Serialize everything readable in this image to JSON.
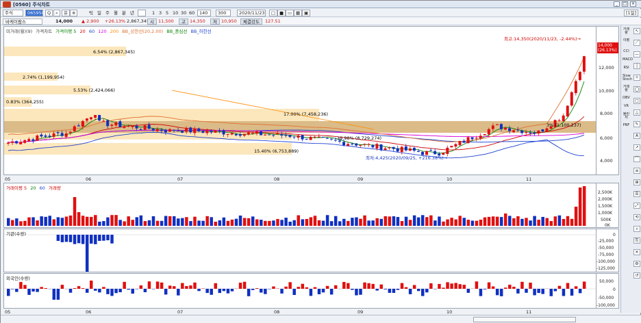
{
  "window": {
    "title": "[0560] 주식차트",
    "controls": [
      "_",
      "□",
      "×"
    ]
  },
  "toolbar": {
    "market": "주식",
    "code": "065950",
    "buttons": [
      "Q",
      "⌕",
      "유",
      "※"
    ],
    "periods": [
      "틱",
      "일",
      "주",
      "월",
      "분",
      "년"
    ],
    "minutes": [
      "1",
      "3",
      "5",
      "10",
      "30",
      "60"
    ],
    "count": "140",
    "count_total": "300",
    "date": "2020/11/23",
    "right_icons": [
      "□",
      "■",
      "▭",
      "▦",
      "▣"
    ],
    "page_label": "[1일]"
  },
  "infobar": {
    "name": "바케이팜스",
    "price": "14,000",
    "change": "▲ 2,900",
    "change_pct": "+26.13%",
    "volume": "2,867,345",
    "open_label": "시",
    "open": "11,500",
    "high_label": "고",
    "high": "14,350",
    "low_label": "저",
    "low": "10,950",
    "strength_label": "체결강도",
    "strength": "127.51"
  },
  "price_panel": {
    "legend": [
      "미거래(월)(9)",
      "가격차트",
      "가격이평 5",
      "20",
      "60",
      "120",
      "200",
      "BB_상한선(20,2.00)",
      "BB_중심선",
      "BB_하한선"
    ],
    "legend_colors": [
      "#444444",
      "#444444",
      "#008000",
      "#d00000",
      "#1b3fd1",
      "#d800d8",
      "#ff8c00",
      "#d87030",
      "#008000",
      "#1b3fd1"
    ],
    "annotations": [
      "6.54% (2,867,345)",
      "2.74% (1,199,954)",
      "5.53% (2,424,066)",
      "0.83% (364,255)",
      "17.00% (7,458,236)",
      "19.98% (8,729,274)",
      "15.40% (6,753,889)",
      "3% (1,100,237)"
    ],
    "high_mark": "최고:14,350(2020/11/23, -2.44%)→",
    "low_mark": "최저:4,425(2020/09/25, +216.38%)→",
    "last_price": "14,000",
    "last_pct": "(26.13%)",
    "y_ticks": [
      "12,000",
      "10,000",
      "8,000",
      "6,000",
      "4,000"
    ]
  },
  "x_labels": [
    "05",
    "06",
    "07",
    "08",
    "09",
    "10",
    "11"
  ],
  "volume_panel": {
    "legend": [
      "거래이평 5",
      "20",
      "60",
      "거래량"
    ],
    "y_ticks": [
      "2,500K",
      "2,000K",
      "1,500K",
      "1,000K",
      "500K",
      "0K"
    ]
  },
  "inst_panel": {
    "title": "기관(수량)",
    "y_ticks": [
      "0",
      "-25,000",
      "-50,000",
      "-75,000",
      "-100,000",
      "-125,000"
    ]
  },
  "foreign_panel": {
    "title": "외국인(수량)",
    "y_ticks": [
      "50,000",
      "0",
      "-50,000",
      "-100,000"
    ]
  },
  "sidebar": [
    "거래량",
    "이평",
    "CCI",
    "MACD",
    "RSI",
    "Slow Stoch",
    "거래량",
    "OBV",
    "VR",
    "볼린저",
    "PNF"
  ],
  "colors": {
    "up": "#e01010",
    "down": "#1030c0",
    "panel_bg": "#ffffff"
  }
}
